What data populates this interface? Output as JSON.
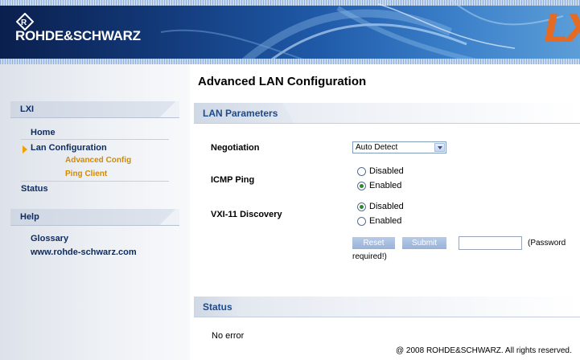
{
  "brand": {
    "name": "ROHDE&SCHWARZ",
    "emblem_icon": "rs-diamond-icon",
    "lxi_logo": "LXI",
    "colors": {
      "banner": "#133a7a",
      "lxi": "#e46b24",
      "nav_text": "#0d2a5e",
      "nav_active": "#d48a00"
    }
  },
  "sidebar": {
    "lxi_header": "LXI",
    "items": [
      {
        "label": "Home"
      },
      {
        "label": "Lan Configuration",
        "active": true
      },
      {
        "label": "Advanced Config",
        "sub": true
      },
      {
        "label": "Ping Client",
        "sub": true
      },
      {
        "label": "Status"
      }
    ],
    "help_header": "Help",
    "help_items": [
      {
        "label": "Glossary"
      },
      {
        "label": "www.rohde-schwarz.com"
      }
    ]
  },
  "main": {
    "title": "Advanced LAN Configuration",
    "lan_section": "LAN Parameters",
    "negotiation": {
      "label": "Negotiation",
      "value": "Auto Detect"
    },
    "icmp_ping": {
      "label": "ICMP Ping",
      "options": [
        "Disabled",
        "Enabled"
      ],
      "selected": "Enabled"
    },
    "vxi11": {
      "label": "VXI-11 Discovery",
      "options": [
        "Disabled",
        "Enabled"
      ],
      "selected": "Disabled"
    },
    "reset_label": "Reset",
    "submit_label": "Submit",
    "password_note_1": "(Password",
    "password_note_2": "required!)",
    "status_section": "Status",
    "status_text": "No error"
  },
  "footer": "@ 2008 ROHDE&SCHWARZ. All rights reserved."
}
